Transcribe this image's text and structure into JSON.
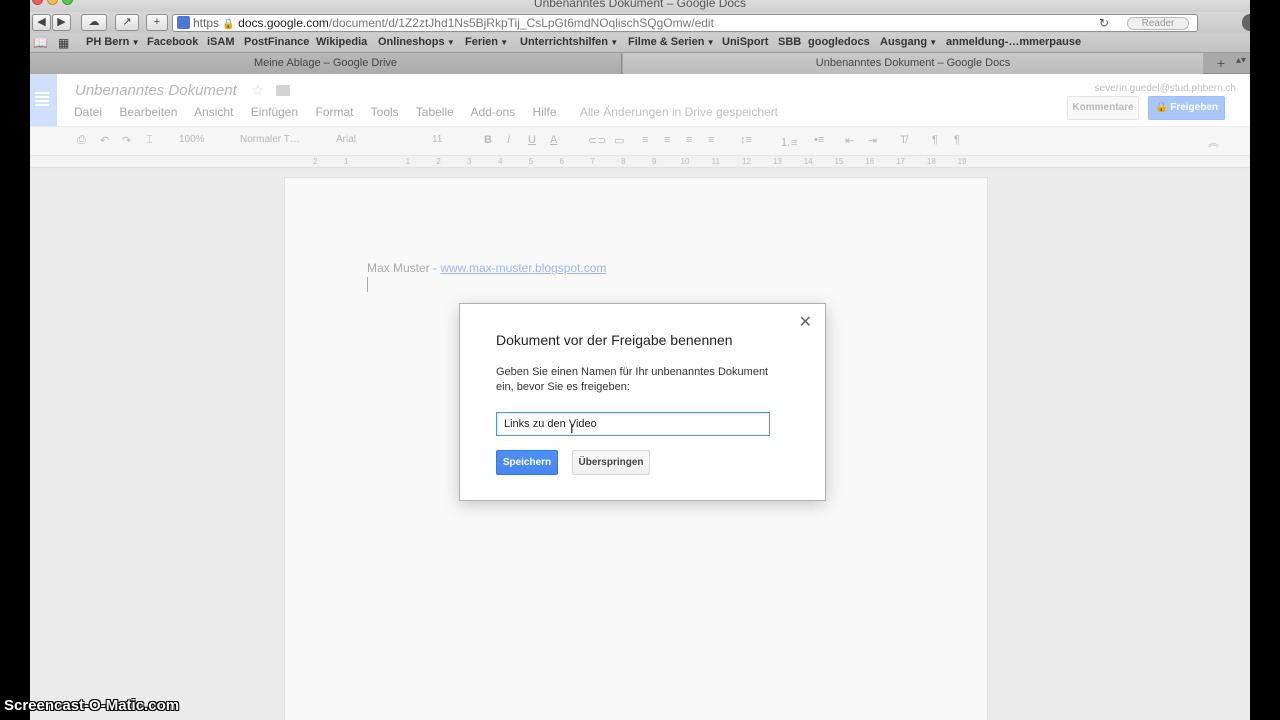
{
  "window": {
    "title": "Unbenanntes Dokument – Google Docs"
  },
  "toolbar": {
    "url_scheme": "https",
    "url_domain": "docs.google.com",
    "url_path": "/document/d/1Z2ztJhd1Ns5BjRkpTij_CsLpGt6mdNOqlischSQgOmw/edit",
    "reader_label": "Reader"
  },
  "bookmarks": [
    {
      "label": "PH Bern",
      "menu": true
    },
    {
      "label": "Facebook"
    },
    {
      "label": "iSAM"
    },
    {
      "label": "PostFinance"
    },
    {
      "label": "Wikipedia"
    },
    {
      "label": "Onlineshops",
      "menu": true
    },
    {
      "label": "Ferien",
      "menu": true
    },
    {
      "label": "Unterrichtshilfen",
      "menu": true
    },
    {
      "label": "Filme & Serien",
      "menu": true
    },
    {
      "label": "UniSport"
    },
    {
      "label": "SBB"
    },
    {
      "label": "googledocs"
    },
    {
      "label": "Ausgang",
      "menu": true
    },
    {
      "label": "anmeldung-…mmerpause"
    }
  ],
  "tabs": [
    {
      "label": "Meine Ablage – Google Drive"
    },
    {
      "label": "Unbenanntes Dokument – Google Docs"
    }
  ],
  "docs": {
    "title": "Unbenanntes Dokument",
    "menu": [
      "Datei",
      "Bearbeiten",
      "Ansicht",
      "Einfügen",
      "Format",
      "Tools",
      "Tabelle",
      "Add-ons",
      "Hilfe"
    ],
    "saved_status": "Alle Änderungen in Drive gespeichert",
    "user_email": "severin.guedel@stud.phbern.ch",
    "comments_label": "Kommentare",
    "share_label": "Freigeben"
  },
  "format_toolbar": {
    "zoom": "100%",
    "style": "Normaler T…",
    "font": "Arial",
    "size": "11"
  },
  "ruler": [
    "2",
    "1",
    "",
    "1",
    "2",
    "3",
    "4",
    "5",
    "6",
    "7",
    "8",
    "9",
    "10",
    "11",
    "12",
    "13",
    "14",
    "15",
    "16",
    "17",
    "18",
    "19"
  ],
  "page": {
    "author_text": "Max Muster - ",
    "link_text": "www.max-muster.blogspot.com"
  },
  "dialog": {
    "title": "Dokument vor der Freigabe benennen",
    "description": "Geben Sie einen Namen für Ihr unbenanntes Dokument ein, bevor Sie es freigeben:",
    "input_value": "Links zu den Video",
    "save_label": "Speichern",
    "skip_label": "Überspringen"
  },
  "watermark": "Screencast-O-Matic.com",
  "colors": {
    "accent": "#4d90fe",
    "share_button": "#a9c6f8",
    "link": "#9ab6e6"
  }
}
